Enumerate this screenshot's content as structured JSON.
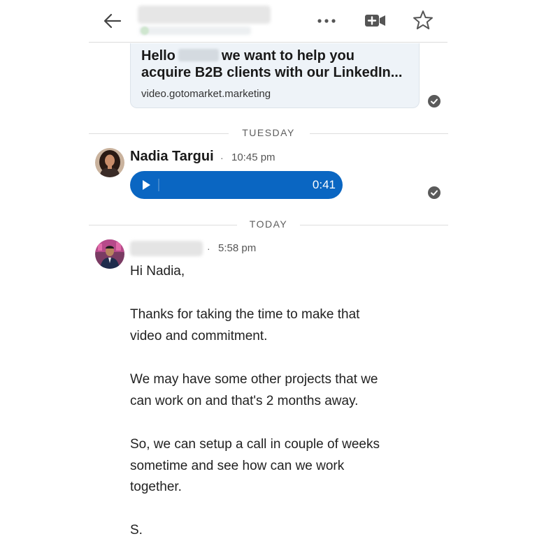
{
  "header": {
    "back_icon": "arrow-left-icon",
    "more_icon": "ellipsis-icon",
    "video_icon": "video-add-icon",
    "star_icon": "star-outline-icon"
  },
  "link_preview": {
    "title_before": "Hello",
    "title_after": "we want to help you",
    "title_line2": "acquire B2B clients with our LinkedIn...",
    "url": "video.gotomarket.marketing"
  },
  "dividers": {
    "first": "TUESDAY",
    "second": "TODAY"
  },
  "voice_message": {
    "sender": "Nadia Targui",
    "time": "10:45 pm",
    "duration": "0:41",
    "play_icon": "play-icon",
    "accent_color": "#0a66c2"
  },
  "text_message": {
    "time": "5:58 pm",
    "lines": [
      "Hi Nadia,",
      "Thanks for taking the time to make that",
      "video and commitment.",
      "We may have some other projects that we",
      "can work on and that's 2 months away.",
      "So, we can setup a call in couple of weeks",
      "sometime and see how can we work",
      "together.",
      "S."
    ]
  },
  "separator": "·"
}
